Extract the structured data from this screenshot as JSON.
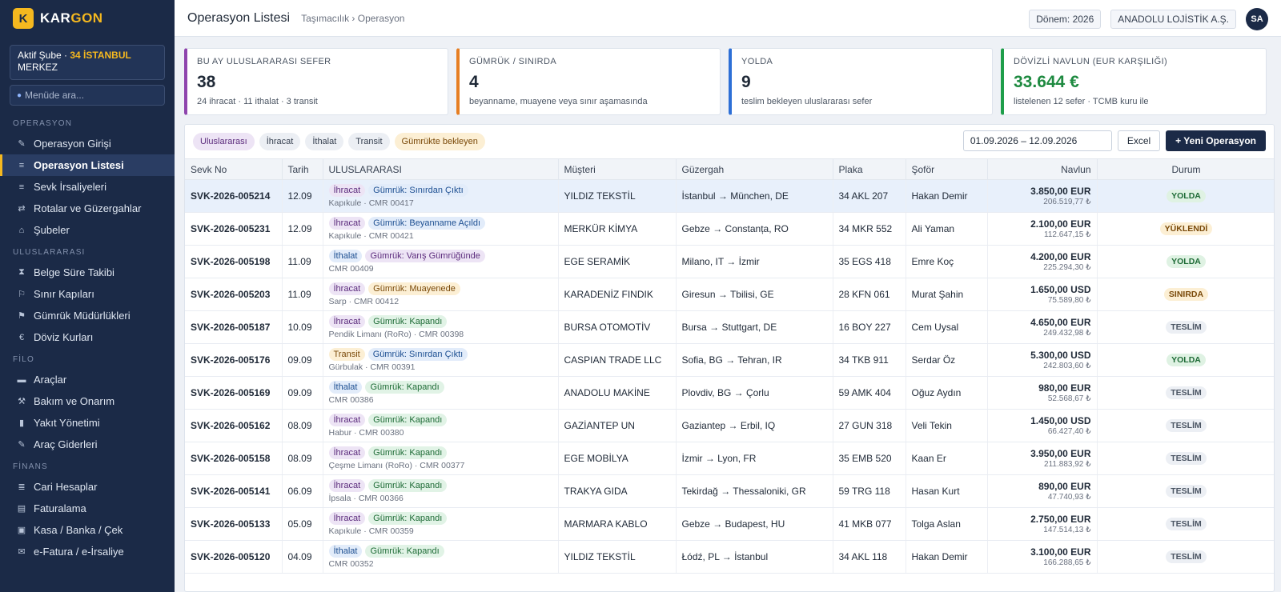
{
  "brand": {
    "logo_letter": "K",
    "name_part1": "KAR",
    "name_part2": "GON"
  },
  "sidebar": {
    "branch_prefix": "Aktif Şube ·",
    "branch_code": "34 İSTANBUL",
    "branch_name": "MERKEZ",
    "search_placeholder": "Menüde ara...",
    "sections": [
      {
        "title": "OPERASYON",
        "items": [
          {
            "label": "Operasyon Girişi",
            "icon": "✎",
            "icon_name": "pencil-icon"
          },
          {
            "label": "Operasyon Listesi",
            "icon": "≡",
            "icon_name": "list-icon",
            "active": true
          },
          {
            "label": "Sevk İrsaliyeleri",
            "icon": "≡",
            "icon_name": "document-list-icon"
          },
          {
            "label": "Rotalar ve Güzergahlar",
            "icon": "⇄",
            "icon_name": "route-icon"
          },
          {
            "label": "Şubeler",
            "icon": "⌂",
            "icon_name": "home-icon"
          }
        ]
      },
      {
        "title": "ULUSLARARASI",
        "items": [
          {
            "label": "Belge Süre Takibi",
            "icon": "⧗",
            "icon_name": "hourglass-icon"
          },
          {
            "label": "Sınır Kapıları",
            "icon": "⚐",
            "icon_name": "flag-icon"
          },
          {
            "label": "Gümrük Müdürlükleri",
            "icon": "⚑",
            "icon_name": "customs-flag-icon"
          },
          {
            "label": "Döviz Kurları",
            "icon": "€",
            "icon_name": "euro-icon"
          }
        ]
      },
      {
        "title": "FİLO",
        "items": [
          {
            "label": "Araçlar",
            "icon": "▬",
            "icon_name": "truck-icon"
          },
          {
            "label": "Bakım ve Onarım",
            "icon": "⚒",
            "icon_name": "tools-icon"
          },
          {
            "label": "Yakıt Yönetimi",
            "icon": "▮",
            "icon_name": "fuel-icon"
          },
          {
            "label": "Araç Giderleri",
            "icon": "✎",
            "icon_name": "expense-icon"
          }
        ]
      },
      {
        "title": "FİNANS",
        "items": [
          {
            "label": "Cari Hesaplar",
            "icon": "≣",
            "icon_name": "accounts-icon"
          },
          {
            "label": "Faturalama",
            "icon": "▤",
            "icon_name": "invoice-icon"
          },
          {
            "label": "Kasa / Banka / Çek",
            "icon": "▣",
            "icon_name": "bank-icon"
          },
          {
            "label": "e-Fatura / e-İrsaliye",
            "icon": "✉",
            "icon_name": "envelope-icon"
          }
        ]
      }
    ]
  },
  "header": {
    "title": "Operasyon Listesi",
    "breadcrumb": "Taşımacılık › Operasyon",
    "period": "Dönem: 2026",
    "company": "ANADOLU LOJİSTİK A.Ş.",
    "avatar": "SA"
  },
  "stats": [
    {
      "label": "BU AY ULUSLARARASI SEFER",
      "value": "38",
      "sub": "24 ihracat · 11 ithalat · 3 transit",
      "color": "#8e44ad",
      "value_color": "#1f2937"
    },
    {
      "label": "GÜMRÜK / SINIRDA",
      "value": "4",
      "sub": "beyanname, muayene veya sınır aşamasında",
      "color": "#e67e22",
      "value_color": "#1f2937"
    },
    {
      "label": "YOLDA",
      "value": "9",
      "sub": "teslim bekleyen uluslararası sefer",
      "color": "#2d6fd6",
      "value_color": "#1f2937"
    },
    {
      "label": "DÖVİZLİ NAVLUN (EUR KARŞILIĞI)",
      "value": "33.644 €",
      "sub": "listelenen 12 sefer · TCMB kuru ile",
      "color": "#1e9e4a",
      "value_color": "#1e8a40"
    }
  ],
  "filters": {
    "chips": [
      {
        "label": "Uluslararası",
        "kind": "intl"
      },
      {
        "label": "İhracat",
        "kind": "plain"
      },
      {
        "label": "İthalat",
        "kind": "plain"
      },
      {
        "label": "Transit",
        "kind": "plain"
      },
      {
        "label": "Gümrükte bekleyen",
        "kind": "customs"
      }
    ],
    "date_range": "01.09.2026 – 12.09.2026",
    "excel_label": "Excel",
    "new_label": "+ Yeni Operasyon"
  },
  "table": {
    "columns": [
      "Sevk No",
      "Tarih",
      "ULUSLARARASI",
      "Müşteri",
      "Güzergah",
      "Plaka",
      "Şoför",
      "Navlun",
      "Durum"
    ],
    "rows": [
      {
        "sevk": "SVK-2026-005214",
        "tarih": "12.09",
        "type": "İhracat",
        "type_kind": "export",
        "customs": "Gümrük: Sınırdan Çıktı",
        "customs_kind": "c-blue",
        "sub": "Kapıkule · CMR 00417",
        "musteri": "YILDIZ TEKSTİL",
        "guzergah": "İstanbul → München, DE",
        "plaka": "34 AKL 207",
        "sofor": "Hakan Demir",
        "amount": "3.850,00 EUR",
        "amount_try": "206.519,77 ₺",
        "durum": "YOLDA",
        "durum_kind": "st-yolda",
        "selected": true
      },
      {
        "sevk": "SVK-2026-005231",
        "tarih": "12.09",
        "type": "İhracat",
        "type_kind": "export",
        "customs": "Gümrük: Beyanname Açıldı",
        "customs_kind": "c-blue",
        "sub": "Kapıkule · CMR 00421",
        "musteri": "MERKÜR KİMYA",
        "guzergah": "Gebze → Constanța, RO",
        "plaka": "34 MKR 552",
        "sofor": "Ali Yaman",
        "amount": "2.100,00 EUR",
        "amount_try": "112.647,15 ₺",
        "durum": "YÜKLENDİ",
        "durum_kind": "st-yuklendi"
      },
      {
        "sevk": "SVK-2026-005198",
        "tarih": "11.09",
        "type": "İthalat",
        "type_kind": "import",
        "customs": "Gümrük: Varış Gümrüğünde",
        "customs_kind": "c-purple",
        "sub": "CMR 00409",
        "musteri": "EGE SERAMİK",
        "guzergah": "Milano, IT → İzmir",
        "plaka": "35 EGS 418",
        "sofor": "Emre Koç",
        "amount": "4.200,00 EUR",
        "amount_try": "225.294,30 ₺",
        "durum": "YOLDA",
        "durum_kind": "st-yolda"
      },
      {
        "sevk": "SVK-2026-005203",
        "tarih": "11.09",
        "type": "İhracat",
        "type_kind": "export",
        "customs": "Gümrük: Muayenede",
        "customs_kind": "c-amber",
        "sub": "Sarp · CMR 00412",
        "musteri": "KARADENİZ FINDIK",
        "guzergah": "Giresun → Tbilisi, GE",
        "plaka": "28 KFN 061",
        "sofor": "Murat Şahin",
        "amount": "1.650,00 USD",
        "amount_try": "75.589,80 ₺",
        "durum": "SINIRDA",
        "durum_kind": "st-sinirda"
      },
      {
        "sevk": "SVK-2026-005187",
        "tarih": "10.09",
        "type": "İhracat",
        "type_kind": "export",
        "customs": "Gümrük: Kapandı",
        "customs_kind": "c-green",
        "sub": "Pendik Limanı (RoRo) · CMR 00398",
        "musteri": "BURSA OTOMOTİV",
        "guzergah": "Bursa → Stuttgart, DE",
        "plaka": "16 BOY 227",
        "sofor": "Cem Uysal",
        "amount": "4.650,00 EUR",
        "amount_try": "249.432,98 ₺",
        "durum": "TESLİM",
        "durum_kind": "st-teslim"
      },
      {
        "sevk": "SVK-2026-005176",
        "tarih": "09.09",
        "type": "Transit",
        "type_kind": "transit",
        "customs": "Gümrük: Sınırdan Çıktı",
        "customs_kind": "c-blue",
        "sub": "Gürbulak · CMR 00391",
        "musteri": "CASPIAN TRADE LLC",
        "guzergah": "Sofia, BG → Tehran, IR",
        "plaka": "34 TKB 911",
        "sofor": "Serdar Öz",
        "amount": "5.300,00 USD",
        "amount_try": "242.803,60 ₺",
        "durum": "YOLDA",
        "durum_kind": "st-yolda"
      },
      {
        "sevk": "SVK-2026-005169",
        "tarih": "09.09",
        "type": "İthalat",
        "type_kind": "import",
        "customs": "Gümrük: Kapandı",
        "customs_kind": "c-green",
        "sub": "CMR 00386",
        "musteri": "ANADOLU MAKİNE",
        "guzergah": "Plovdiv, BG → Çorlu",
        "plaka": "59 AMK 404",
        "sofor": "Oğuz Aydın",
        "amount": "980,00 EUR",
        "amount_try": "52.568,67 ₺",
        "durum": "TESLİM",
        "durum_kind": "st-teslim"
      },
      {
        "sevk": "SVK-2026-005162",
        "tarih": "08.09",
        "type": "İhracat",
        "type_kind": "export",
        "customs": "Gümrük: Kapandı",
        "customs_kind": "c-green",
        "sub": "Habur · CMR 00380",
        "musteri": "GAZİANTEP UN",
        "guzergah": "Gaziantep → Erbil, IQ",
        "plaka": "27 GUN 318",
        "sofor": "Veli Tekin",
        "amount": "1.450,00 USD",
        "amount_try": "66.427,40 ₺",
        "durum": "TESLİM",
        "durum_kind": "st-teslim"
      },
      {
        "sevk": "SVK-2026-005158",
        "tarih": "08.09",
        "type": "İhracat",
        "type_kind": "export",
        "customs": "Gümrük: Kapandı",
        "customs_kind": "c-green",
        "sub": "Çeşme Limanı (RoRo) · CMR 00377",
        "musteri": "EGE MOBİLYA",
        "guzergah": "İzmir → Lyon, FR",
        "plaka": "35 EMB 520",
        "sofor": "Kaan Er",
        "amount": "3.950,00 EUR",
        "amount_try": "211.883,92 ₺",
        "durum": "TESLİM",
        "durum_kind": "st-teslim"
      },
      {
        "sevk": "SVK-2026-005141",
        "tarih": "06.09",
        "type": "İhracat",
        "type_kind": "export",
        "customs": "Gümrük: Kapandı",
        "customs_kind": "c-green",
        "sub": "İpsala · CMR 00366",
        "musteri": "TRAKYA GIDA",
        "guzergah": "Tekirdağ → Thessaloniki, GR",
        "plaka": "59 TRG 118",
        "sofor": "Hasan Kurt",
        "amount": "890,00 EUR",
        "amount_try": "47.740,93 ₺",
        "durum": "TESLİM",
        "durum_kind": "st-teslim"
      },
      {
        "sevk": "SVK-2026-005133",
        "tarih": "05.09",
        "type": "İhracat",
        "type_kind": "export",
        "customs": "Gümrük: Kapandı",
        "customs_kind": "c-green",
        "sub": "Kapıkule · CMR 00359",
        "musteri": "MARMARA KABLO",
        "guzergah": "Gebze → Budapest, HU",
        "plaka": "41 MKB 077",
        "sofor": "Tolga Aslan",
        "amount": "2.750,00 EUR",
        "amount_try": "147.514,13 ₺",
        "durum": "TESLİM",
        "durum_kind": "st-teslim"
      },
      {
        "sevk": "SVK-2026-005120",
        "tarih": "04.09",
        "type": "İthalat",
        "type_kind": "import",
        "customs": "Gümrük: Kapandı",
        "customs_kind": "c-green",
        "sub": "CMR 00352",
        "musteri": "YILDIZ TEKSTİL",
        "guzergah": "Łódź, PL → İstanbul",
        "plaka": "34 AKL 118",
        "sofor": "Hakan Demir",
        "amount": "3.100,00 EUR",
        "amount_try": "166.288,65 ₺",
        "durum": "TESLİM",
        "durum_kind": "st-teslim"
      }
    ]
  }
}
